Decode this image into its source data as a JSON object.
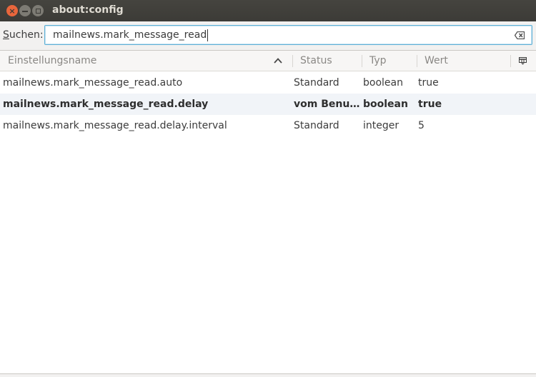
{
  "window": {
    "title": "about:config"
  },
  "search": {
    "label_first": "S",
    "label_rest": "uchen:",
    "value": "mailnews.mark_message_read"
  },
  "columns": {
    "name": "Einstellungsname",
    "status": "Status",
    "type": "Typ",
    "value": "Wert"
  },
  "rows": [
    {
      "name": "mailnews.mark_message_read.auto",
      "status": "Standard",
      "type": "boolean",
      "value": "true"
    },
    {
      "name": "mailnews.mark_message_read.delay",
      "status": "vom Benut…",
      "type": "boolean",
      "value": "true"
    },
    {
      "name": "mailnews.mark_message_read.delay.interval",
      "status": "Standard",
      "type": "integer",
      "value": "5"
    }
  ],
  "icons": {
    "close": "close-icon",
    "minimize": "minimize-icon",
    "maximize": "maximize-icon",
    "clear": "clear-search-icon",
    "sort": "sort-ascending-icon",
    "column_picker": "column-picker-icon"
  },
  "colors": {
    "titlebar": "#3c3b37",
    "close_button": "#e9663c",
    "search_focus": "#5fb0d6",
    "alt_row": "#f1f4f8"
  }
}
